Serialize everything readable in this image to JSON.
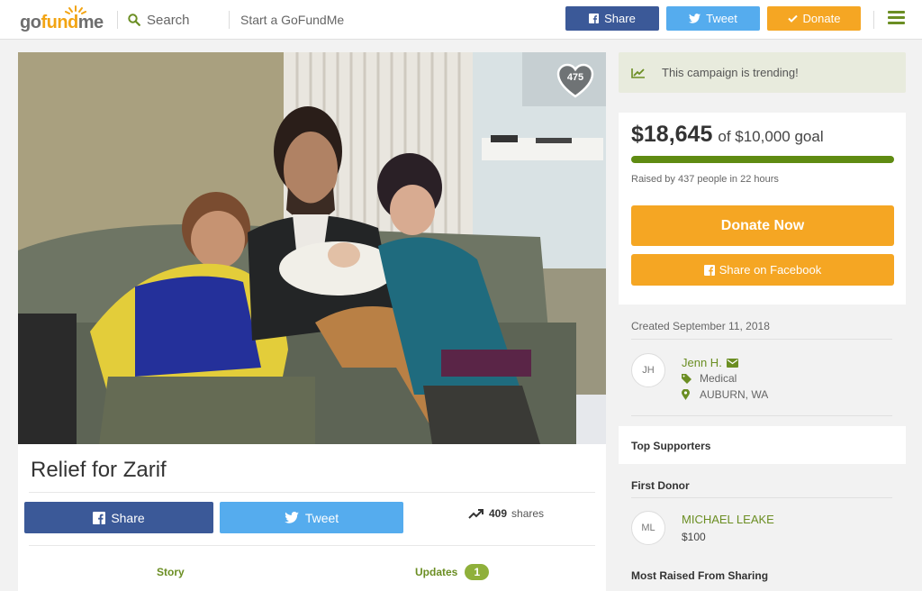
{
  "header": {
    "logo": {
      "go": "go",
      "fund": "fund",
      "me": "me"
    },
    "search_label": "Search",
    "start_link": "Start a GoFundMe",
    "share_label": "Share",
    "tweet_label": "Tweet",
    "donate_label": "Donate"
  },
  "photo": {
    "hearts_count": "475"
  },
  "campaign": {
    "title": "Relief for Zarif",
    "share_label": "Share",
    "tweet_label": "Tweet",
    "shares_count": "409",
    "shares_label": "shares",
    "tabs": [
      {
        "label": "Story"
      },
      {
        "label": "Updates",
        "badge": "1"
      }
    ]
  },
  "sidebar": {
    "trending_text": "This campaign is trending!",
    "raised_amount": "$18,645",
    "goal_text": "of $10,000 goal",
    "progress_fraction": 1.0,
    "raised_by": "Raised by 437 people in 22 hours",
    "donate_now": "Donate Now",
    "share_facebook": "Share on Facebook",
    "created": "Created September 11, 2018",
    "organizer": {
      "initials": "JH",
      "name": "Jenn H.",
      "category": "Medical",
      "location": "AUBURN, WA"
    },
    "top_supporters": "Top Supporters",
    "first_donor_heading": "First Donor",
    "first_donor": {
      "initials": "ML",
      "name": "MICHAEL LEAKE",
      "amount": "$100"
    },
    "most_raised_heading": "Most Raised From Sharing"
  },
  "colors": {
    "facebook": "#3b5998",
    "twitter": "#55acee",
    "donate": "#f5a623",
    "brand_green": "#6b8e23",
    "progress": "#5f8b12"
  }
}
